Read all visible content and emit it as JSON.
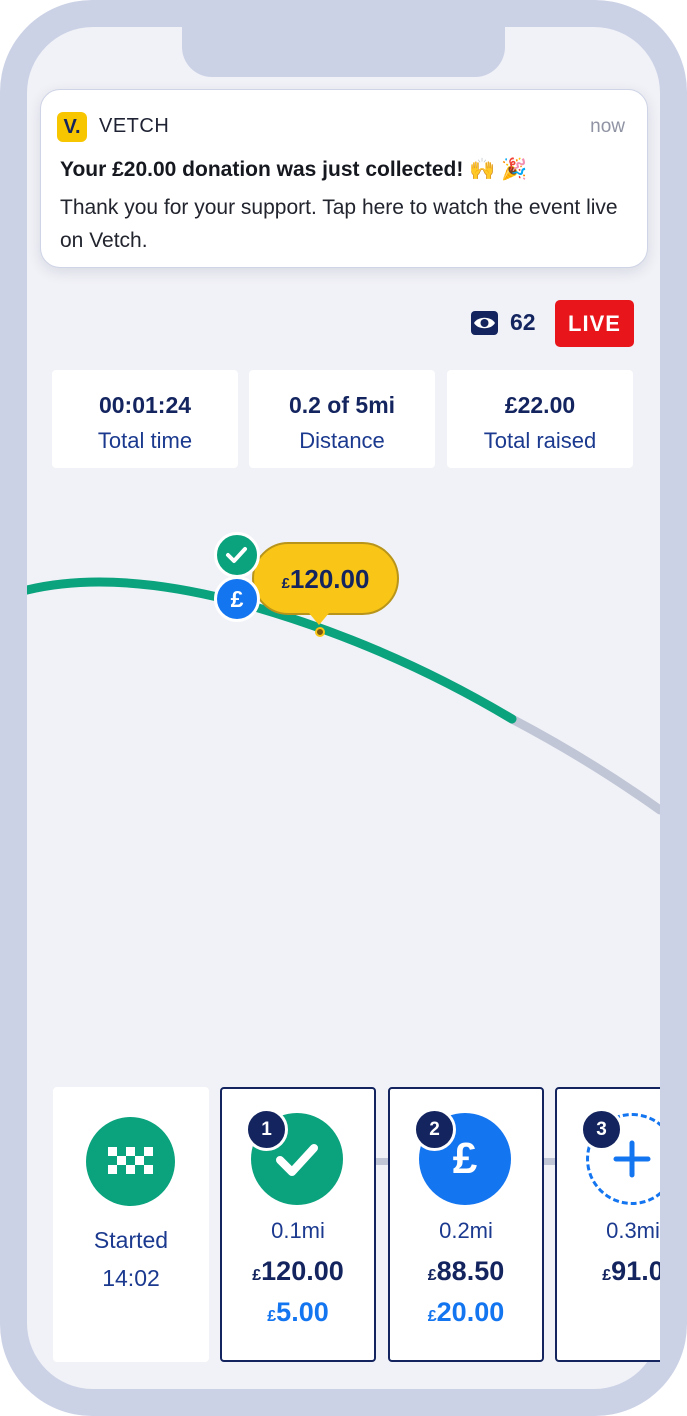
{
  "notification": {
    "app_icon_letter": "V.",
    "app_name": "VETCH",
    "time": "now",
    "title": "Your £20.00 donation was just collected! 🙌 🎉",
    "body": "Thank you for your support. Tap here to watch the event live on Vetch."
  },
  "live": {
    "viewers": "62",
    "badge": "LIVE"
  },
  "stats": [
    {
      "value": "00:01:24",
      "label": "Total time"
    },
    {
      "value": "0.2 of 5mi",
      "label": "Distance"
    },
    {
      "value": "£22.00",
      "label": "Total raised"
    }
  ],
  "map": {
    "bubble_currency": "£",
    "bubble_amount": "120.00",
    "pin_symbol": "£"
  },
  "timeline": {
    "start": {
      "label": "Started",
      "time": "14:02"
    },
    "milestones": [
      {
        "number": "1",
        "distance": "0.1mi",
        "currency": "£",
        "amount": "120.00",
        "donation": "5.00",
        "status": "completed"
      },
      {
        "number": "2",
        "distance": "0.2mi",
        "currency": "£",
        "amount": "88.50",
        "donation": "20.00",
        "status": "current",
        "symbol": "£"
      },
      {
        "number": "3",
        "distance": "0.3mi",
        "currency": "£",
        "amount": "91.0",
        "status": "upcoming"
      }
    ]
  },
  "colors": {
    "navy": "#13245f",
    "green": "#0aa37d",
    "blue": "#1475f0",
    "yellow": "#f9c617",
    "live_red": "#e8151b",
    "route_gray": "#c0c6d6"
  }
}
